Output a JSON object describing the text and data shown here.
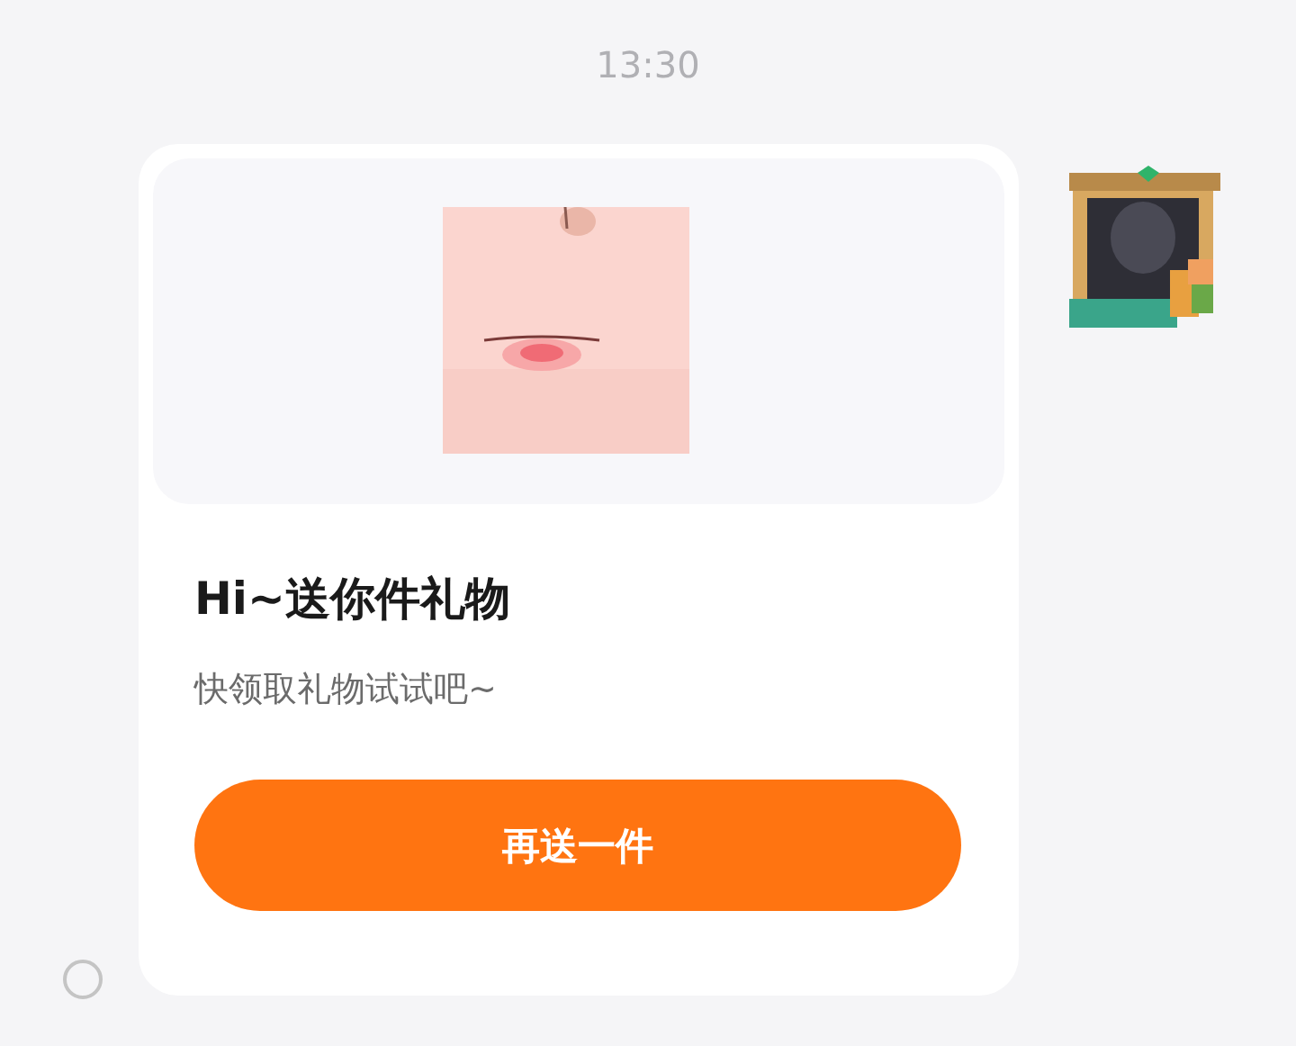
{
  "timestamp": "13:30",
  "message": {
    "selected": false,
    "card": {
      "title": "Hi~送你件礼物",
      "subtitle": "快领取礼物试试吧~",
      "button": "再送一件"
    }
  }
}
